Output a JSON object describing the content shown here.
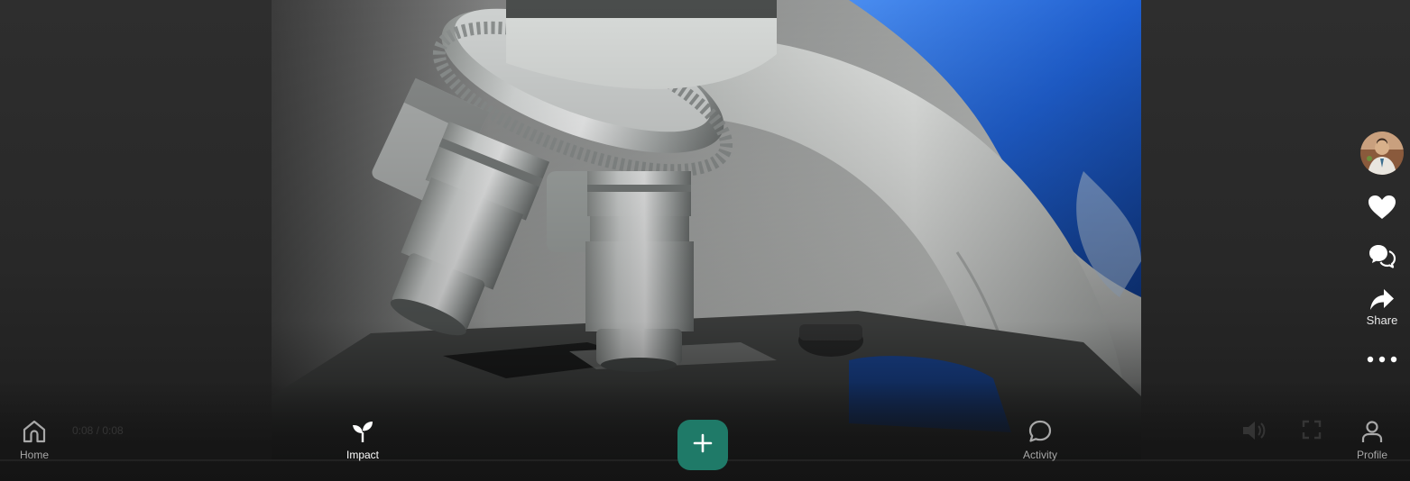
{
  "app": {
    "accent_color": "#1f7a68",
    "background_color": "#2b2b2b"
  },
  "video": {
    "subject_icon": "microscope-video-frame",
    "time_readout": "0:08 / 0:08"
  },
  "rail": {
    "avatar_icon": "user-avatar",
    "like_icon": "heart-icon",
    "comment_icon": "comment-icon",
    "share_icon": "share-arrow-icon",
    "share_label": "Share",
    "more_icon": "more-dots-icon"
  },
  "nav": {
    "items": [
      {
        "label": "Home",
        "icon": "home-icon",
        "active": false
      },
      {
        "label": "Impact",
        "icon": "sprout-icon",
        "active": true
      },
      {
        "label": "Activity",
        "icon": "chat-bubble-icon",
        "active": false
      },
      {
        "label": "Profile",
        "icon": "person-icon",
        "active": false
      }
    ],
    "create_icon": "plus-icon"
  },
  "player": {
    "volume_icon": "volume-icon",
    "fullscreen_icon": "fullscreen-icon"
  }
}
